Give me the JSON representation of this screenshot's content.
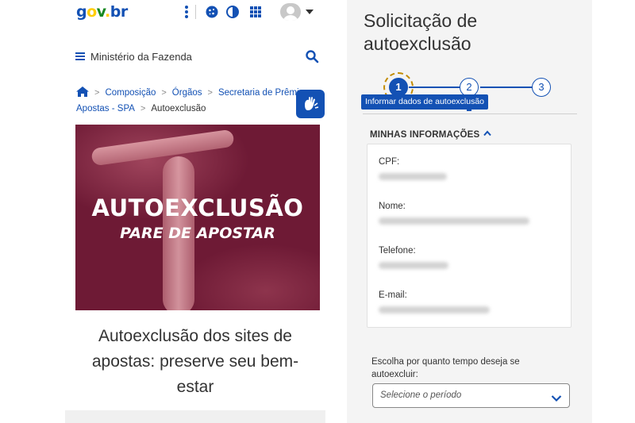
{
  "left": {
    "logo": {
      "g": "g",
      "o": "o",
      "v": "v",
      "dot": ".",
      "br": "br"
    },
    "navbar": {
      "ministry": "Ministério da Fazenda"
    },
    "breadcrumb": {
      "items": [
        "Composição",
        "Órgãos",
        "Secretaria de Prêmios e Apostas - SPA"
      ],
      "current": "Autoexclusão",
      "separator": ">"
    },
    "banner": {
      "title": "AUTOEXCLUSÃO",
      "subtitle": "PARE DE APOSTAR"
    },
    "article_title": "Autoexclusão dos sites de apostas: preserve seu bem-estar"
  },
  "right": {
    "title": "Solicitação de autoexclusão",
    "stepper": {
      "steps": [
        "1",
        "2",
        "3"
      ],
      "current_step": 1,
      "tooltip": "Informar dados de autoexclusão"
    },
    "info": {
      "header": "MINHAS INFORMAÇÕES",
      "fields": [
        {
          "label": "CPF:"
        },
        {
          "label": "Nome:"
        },
        {
          "label": "Telefone:"
        },
        {
          "label": "E-mail:"
        }
      ]
    },
    "period": {
      "label": "Escolha por quanto tempo deseja se autoexcluir:",
      "placeholder": "Selecione o período"
    }
  },
  "colors": {
    "brand_blue": "#1351b4",
    "govbr_yellow": "#ffcd07",
    "govbr_green": "#168821",
    "banner_wine": "#6e1a35",
    "focus_ring": "#c28b00"
  },
  "icons": [
    "kebab-menu-icon",
    "cookie-icon",
    "contrast-icon",
    "apps-grid-icon",
    "avatar-icon",
    "chevron-down-icon",
    "hamburger-menu-icon",
    "search-icon",
    "home-icon",
    "sign-language-icon",
    "chevron-up-icon"
  ]
}
